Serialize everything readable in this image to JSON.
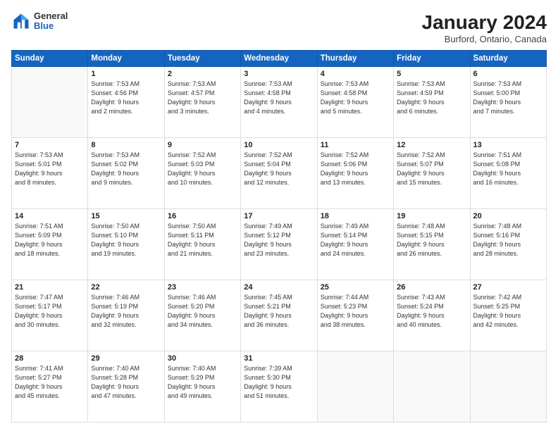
{
  "header": {
    "logo_general": "General",
    "logo_blue": "Blue",
    "month_year": "January 2024",
    "location": "Burford, Ontario, Canada"
  },
  "weekdays": [
    "Sunday",
    "Monday",
    "Tuesday",
    "Wednesday",
    "Thursday",
    "Friday",
    "Saturday"
  ],
  "weeks": [
    [
      {
        "day": "",
        "info": ""
      },
      {
        "day": "1",
        "info": "Sunrise: 7:53 AM\nSunset: 4:56 PM\nDaylight: 9 hours\nand 2 minutes."
      },
      {
        "day": "2",
        "info": "Sunrise: 7:53 AM\nSunset: 4:57 PM\nDaylight: 9 hours\nand 3 minutes."
      },
      {
        "day": "3",
        "info": "Sunrise: 7:53 AM\nSunset: 4:58 PM\nDaylight: 9 hours\nand 4 minutes."
      },
      {
        "day": "4",
        "info": "Sunrise: 7:53 AM\nSunset: 4:58 PM\nDaylight: 9 hours\nand 5 minutes."
      },
      {
        "day": "5",
        "info": "Sunrise: 7:53 AM\nSunset: 4:59 PM\nDaylight: 9 hours\nand 6 minutes."
      },
      {
        "day": "6",
        "info": "Sunrise: 7:53 AM\nSunset: 5:00 PM\nDaylight: 9 hours\nand 7 minutes."
      }
    ],
    [
      {
        "day": "7",
        "info": "Sunrise: 7:53 AM\nSunset: 5:01 PM\nDaylight: 9 hours\nand 8 minutes."
      },
      {
        "day": "8",
        "info": "Sunrise: 7:53 AM\nSunset: 5:02 PM\nDaylight: 9 hours\nand 9 minutes."
      },
      {
        "day": "9",
        "info": "Sunrise: 7:52 AM\nSunset: 5:03 PM\nDaylight: 9 hours\nand 10 minutes."
      },
      {
        "day": "10",
        "info": "Sunrise: 7:52 AM\nSunset: 5:04 PM\nDaylight: 9 hours\nand 12 minutes."
      },
      {
        "day": "11",
        "info": "Sunrise: 7:52 AM\nSunset: 5:06 PM\nDaylight: 9 hours\nand 13 minutes."
      },
      {
        "day": "12",
        "info": "Sunrise: 7:52 AM\nSunset: 5:07 PM\nDaylight: 9 hours\nand 15 minutes."
      },
      {
        "day": "13",
        "info": "Sunrise: 7:51 AM\nSunset: 5:08 PM\nDaylight: 9 hours\nand 16 minutes."
      }
    ],
    [
      {
        "day": "14",
        "info": "Sunrise: 7:51 AM\nSunset: 5:09 PM\nDaylight: 9 hours\nand 18 minutes."
      },
      {
        "day": "15",
        "info": "Sunrise: 7:50 AM\nSunset: 5:10 PM\nDaylight: 9 hours\nand 19 minutes."
      },
      {
        "day": "16",
        "info": "Sunrise: 7:50 AM\nSunset: 5:11 PM\nDaylight: 9 hours\nand 21 minutes."
      },
      {
        "day": "17",
        "info": "Sunrise: 7:49 AM\nSunset: 5:12 PM\nDaylight: 9 hours\nand 23 minutes."
      },
      {
        "day": "18",
        "info": "Sunrise: 7:49 AM\nSunset: 5:14 PM\nDaylight: 9 hours\nand 24 minutes."
      },
      {
        "day": "19",
        "info": "Sunrise: 7:48 AM\nSunset: 5:15 PM\nDaylight: 9 hours\nand 26 minutes."
      },
      {
        "day": "20",
        "info": "Sunrise: 7:48 AM\nSunset: 5:16 PM\nDaylight: 9 hours\nand 28 minutes."
      }
    ],
    [
      {
        "day": "21",
        "info": "Sunrise: 7:47 AM\nSunset: 5:17 PM\nDaylight: 9 hours\nand 30 minutes."
      },
      {
        "day": "22",
        "info": "Sunrise: 7:46 AM\nSunset: 5:19 PM\nDaylight: 9 hours\nand 32 minutes."
      },
      {
        "day": "23",
        "info": "Sunrise: 7:46 AM\nSunset: 5:20 PM\nDaylight: 9 hours\nand 34 minutes."
      },
      {
        "day": "24",
        "info": "Sunrise: 7:45 AM\nSunset: 5:21 PM\nDaylight: 9 hours\nand 36 minutes."
      },
      {
        "day": "25",
        "info": "Sunrise: 7:44 AM\nSunset: 5:23 PM\nDaylight: 9 hours\nand 38 minutes."
      },
      {
        "day": "26",
        "info": "Sunrise: 7:43 AM\nSunset: 5:24 PM\nDaylight: 9 hours\nand 40 minutes."
      },
      {
        "day": "27",
        "info": "Sunrise: 7:42 AM\nSunset: 5:25 PM\nDaylight: 9 hours\nand 42 minutes."
      }
    ],
    [
      {
        "day": "28",
        "info": "Sunrise: 7:41 AM\nSunset: 5:27 PM\nDaylight: 9 hours\nand 45 minutes."
      },
      {
        "day": "29",
        "info": "Sunrise: 7:40 AM\nSunset: 5:28 PM\nDaylight: 9 hours\nand 47 minutes."
      },
      {
        "day": "30",
        "info": "Sunrise: 7:40 AM\nSunset: 5:29 PM\nDaylight: 9 hours\nand 49 minutes."
      },
      {
        "day": "31",
        "info": "Sunrise: 7:39 AM\nSunset: 5:30 PM\nDaylight: 9 hours\nand 51 minutes."
      },
      {
        "day": "",
        "info": ""
      },
      {
        "day": "",
        "info": ""
      },
      {
        "day": "",
        "info": ""
      }
    ]
  ]
}
